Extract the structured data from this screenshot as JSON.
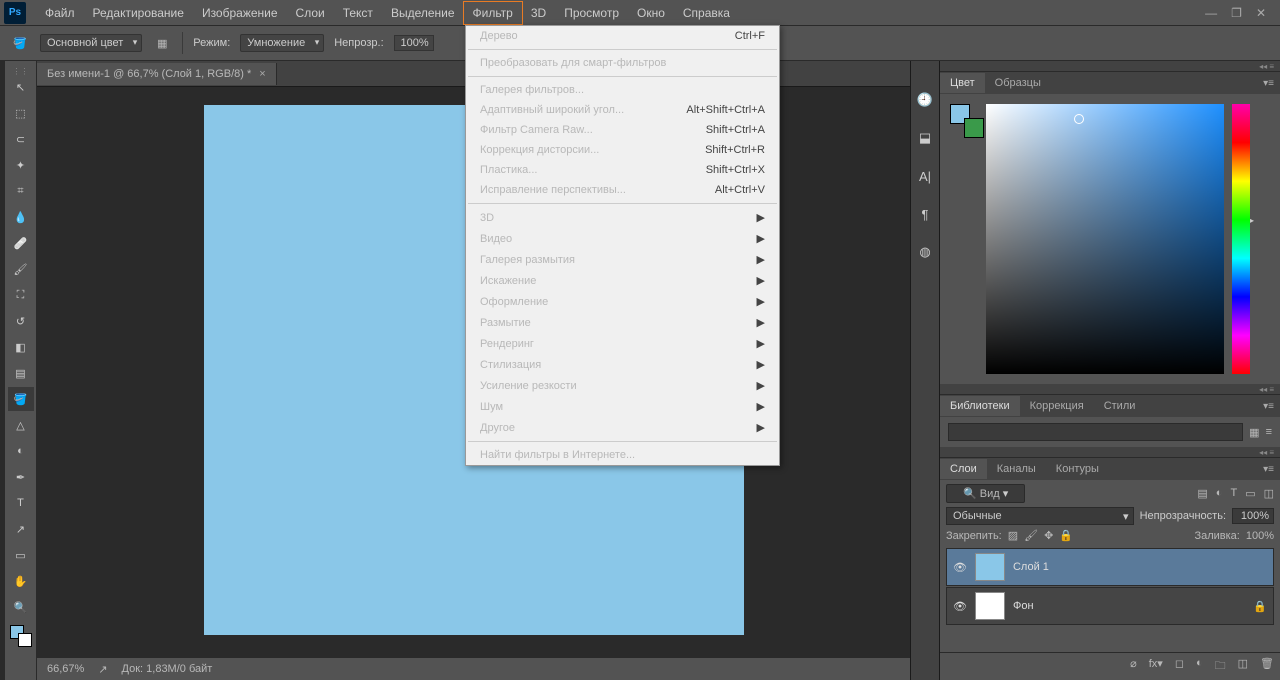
{
  "app": {
    "logo": "Ps"
  },
  "menubar": [
    "Файл",
    "Редактирование",
    "Изображение",
    "Слои",
    "Текст",
    "Выделение",
    "Фильтр",
    "3D",
    "Просмотр",
    "Окно",
    "Справка"
  ],
  "menubar_active_index": 6,
  "win_controls": {
    "min": "—",
    "max": "❐",
    "close": "✕"
  },
  "options": {
    "fg_mode": "Основной цвет",
    "mode_label": "Режим:",
    "blend": "Умножение",
    "opacity_label": "Непрозр.:",
    "opacity": "100%"
  },
  "doc_tab": {
    "title": "Без имени-1 @ 66,7% (Слой 1, RGB/8) *"
  },
  "status": {
    "zoom": "66,67%",
    "docinfo": "Док: 1,83M/0 байт"
  },
  "dropdown": {
    "groups": [
      [
        {
          "label": "Дерево",
          "shortcut": "Ctrl+F"
        }
      ],
      [
        {
          "label": "Преобразовать для смарт-фильтров"
        }
      ],
      [
        {
          "label": "Галерея фильтров..."
        },
        {
          "label": "Адаптивный широкий угол...",
          "shortcut": "Alt+Shift+Ctrl+A"
        },
        {
          "label": "Фильтр Camera Raw...",
          "shortcut": "Shift+Ctrl+A"
        },
        {
          "label": "Коррекция дисторсии...",
          "shortcut": "Shift+Ctrl+R"
        },
        {
          "label": "Пластика...",
          "shortcut": "Shift+Ctrl+X"
        },
        {
          "label": "Исправление перспективы...",
          "shortcut": "Alt+Ctrl+V"
        }
      ],
      [
        {
          "label": "3D",
          "submenu": true
        },
        {
          "label": "Видео",
          "submenu": true
        },
        {
          "label": "Галерея размытия",
          "submenu": true
        },
        {
          "label": "Искажение",
          "submenu": true
        },
        {
          "label": "Оформление",
          "submenu": true
        },
        {
          "label": "Размытие",
          "submenu": true
        },
        {
          "label": "Рендеринг",
          "submenu": true
        },
        {
          "label": "Стилизация",
          "submenu": true
        },
        {
          "label": "Усиление резкости",
          "submenu": true
        },
        {
          "label": "Шум",
          "submenu": true
        },
        {
          "label": "Другое",
          "submenu": true
        }
      ],
      [
        {
          "label": "Найти фильтры в Интернете..."
        }
      ]
    ]
  },
  "panels": {
    "color_tabs": [
      "Цвет",
      "Образцы"
    ],
    "lib_tabs": [
      "Библиотеки",
      "Коррекция",
      "Стили"
    ],
    "layers_tabs": [
      "Слои",
      "Каналы",
      "Контуры"
    ],
    "kind": "Вид",
    "blend_mode": "Обычные",
    "opacity_label": "Непрозрачность:",
    "opacity": "100%",
    "lock_label": "Закрепить:",
    "fill_label": "Заливка:",
    "fill": "100%",
    "layers": [
      {
        "name": "Слой 1",
        "thumb": "#8ac7e8",
        "selected": true,
        "locked": false
      },
      {
        "name": "Фон",
        "thumb": "#ffffff",
        "selected": false,
        "locked": true
      }
    ]
  }
}
